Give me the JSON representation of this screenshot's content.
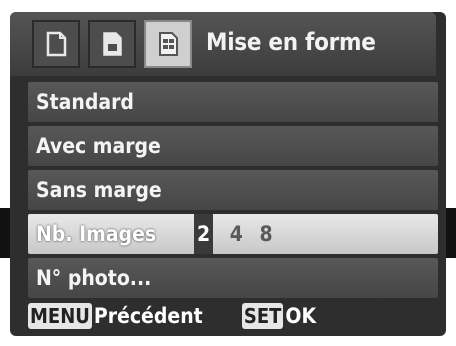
{
  "header": {
    "tabs": [
      {
        "icon": "document-page-icon"
      },
      {
        "icon": "document-print-icon"
      },
      {
        "icon": "layout-grid-icon"
      }
    ],
    "title": "Mise en forme"
  },
  "menu": {
    "items": [
      {
        "label": "Standard"
      },
      {
        "label": "Avec marge"
      },
      {
        "label": "Sans marge"
      },
      {
        "label": "Nb. Images",
        "options": [
          "2",
          "4",
          "8"
        ],
        "selected_option": "2"
      },
      {
        "label": "N° photo..."
      }
    ],
    "selected_index": 3
  },
  "footer": {
    "menu_key": "MENU",
    "menu_action": "Précédent",
    "set_key": "SET",
    "set_action": "OK"
  },
  "colors": {
    "background": "#2e2e2e",
    "item_background": "#505050",
    "selected_item_background": "#d6d6d6",
    "text": "#ffffff"
  }
}
